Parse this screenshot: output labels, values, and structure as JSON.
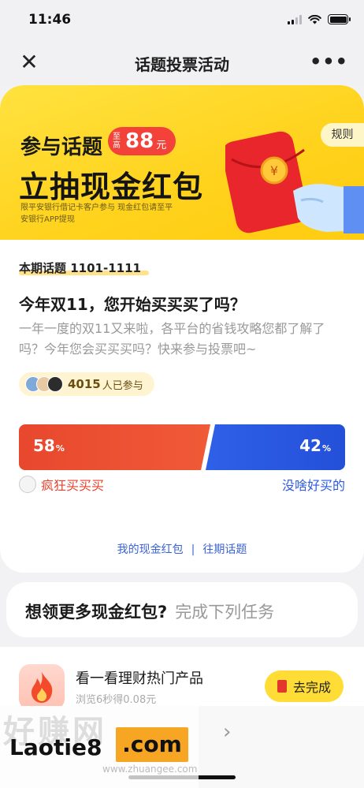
{
  "status_bar": {
    "time": "11:46"
  },
  "nav": {
    "close": "✕",
    "title": "话题投票活动",
    "more": "•••"
  },
  "banner": {
    "line1": "参与话题",
    "badge_prefix": "至高",
    "badge_amount": "88",
    "badge_unit": "元",
    "line2": "立抽现金红包",
    "note": "限平安银行借记卡客户参与 现金红包请至平安银行APP提现",
    "rules": "规则"
  },
  "topic": {
    "period": "本期话题 1101-1111",
    "question": "今年双11，您开始买买买了吗？",
    "description": "一年一度的双11又来啦，各平台的省钱攻略您都了解了吗？今年您会买买买吗？快来参与投票吧~",
    "participants_count": "4015",
    "participants_suffix": "人已参与"
  },
  "vote": {
    "left_pct": "58",
    "right_pct": "42",
    "pct_sign": "%",
    "left_value": 58,
    "right_value": 42,
    "left_option": "疯狂买买买",
    "right_option": "没啥好买的",
    "left_color": "#e8482e",
    "right_color": "#2f60e8"
  },
  "footer_links": {
    "my_redpacket": "我的现金红包",
    "separator": "|",
    "past_topics": "往期话题"
  },
  "tasks": {
    "title": "想领更多现金红包?",
    "subtitle": "完成下列任务"
  },
  "task": {
    "title": "看一看理财热门产品",
    "desc": "浏览6秒得0.08元",
    "button": "去完成"
  },
  "bottom": {
    "back": "‹",
    "forward": "›"
  },
  "watermark": {
    "bg": "好赚网",
    "text": "Laotie8",
    "com": ".com",
    "url": "www.zhuangee.com"
  }
}
